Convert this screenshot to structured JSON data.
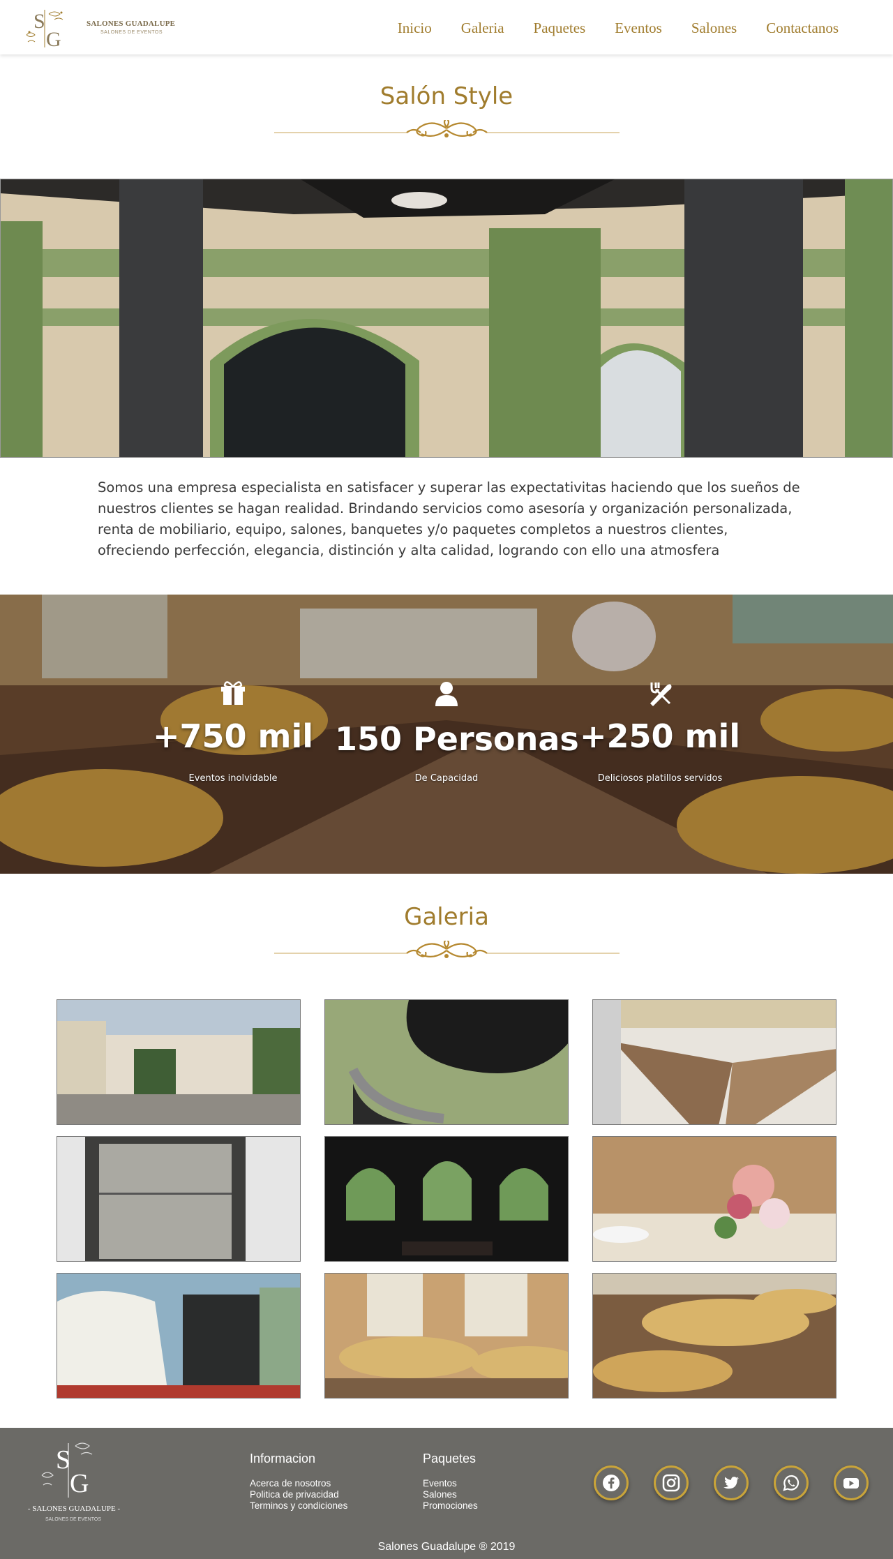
{
  "brand": {
    "name": "SALONES GUADALUPE",
    "subtitle": "SALONES DE EVENTOS",
    "footer_name": "- SALONES GUADALUPE -",
    "footer_subtitle": "SALONES DE EVENTOS"
  },
  "nav": {
    "items": [
      {
        "label": "Inicio"
      },
      {
        "label": "Galeria"
      },
      {
        "label": "Paquetes"
      },
      {
        "label": "Eventos"
      },
      {
        "label": "Salones"
      },
      {
        "label": "Contactanos"
      }
    ]
  },
  "main": {
    "title": "Salón Style",
    "description": "Somos una empresa especialista en satisfacer y superar las expectativitas haciendo que los  sueños de nuestros clientes se hagan  realidad. Brindando servicios como asesoría y organización personalizada, renta de mobiliario, equipo, salones, banquetes y/o  paquetes completos a nuestros clientes, ofreciendo perfección, elegancia, distinción y alta calidad, logrando  con ello  una  atmosfera"
  },
  "stats": [
    {
      "icon": "gift-icon",
      "value": "+750 mil",
      "label": "Eventos inolvidable"
    },
    {
      "icon": "user-icon",
      "value": "150 Personas",
      "label": "De Capacidad"
    },
    {
      "icon": "utensils-icon",
      "value": "+250 mil",
      "label": "Deliciosos platillos servidos"
    }
  ],
  "gallery": {
    "title": "Galeria",
    "images": [
      {
        "subject": "building-exterior"
      },
      {
        "subject": "ceiling-detail"
      },
      {
        "subject": "tiled-floor"
      },
      {
        "subject": "door-panel"
      },
      {
        "subject": "arched-windows"
      },
      {
        "subject": "flower-centerpiece"
      },
      {
        "subject": "entrance-facade"
      },
      {
        "subject": "dining-tables"
      },
      {
        "subject": "banquet-hall"
      }
    ]
  },
  "footer": {
    "info": {
      "title": "Informacion",
      "links": [
        "Acerca de nosotros",
        "Politica de privacidad",
        "Terminos y condiciones"
      ]
    },
    "packages": {
      "title": "Paquetes",
      "links": [
        "Eventos",
        "Salones",
        "Promociones"
      ]
    },
    "social": [
      "facebook-icon",
      "instagram-icon",
      "twitter-icon",
      "whatsapp-icon",
      "youtube-icon"
    ],
    "copyright": "Salones Guadalupe ® 2019"
  },
  "colors": {
    "accent": "#a07c2d",
    "footer_bg": "#6b6a66",
    "social_ring": "#c9a43a"
  }
}
